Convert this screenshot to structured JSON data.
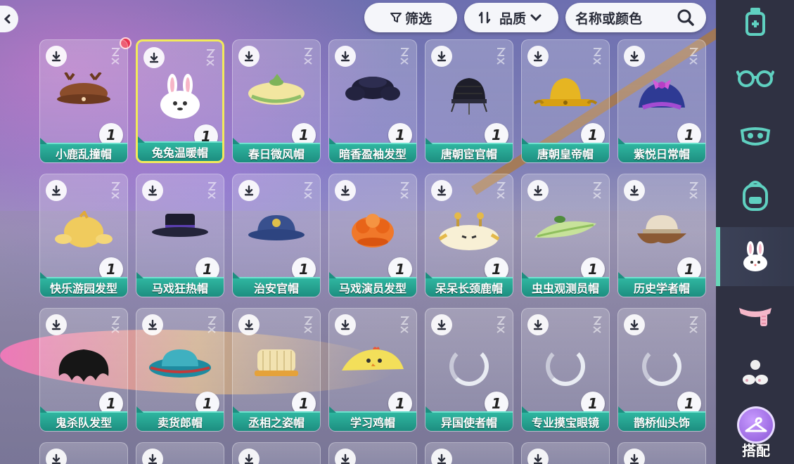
{
  "toolbar": {
    "filter_label": "筛选",
    "sort_label": "品质",
    "search_placeholder": "名称或颜色"
  },
  "sidebar": {
    "categories": [
      {
        "icon": "potion-bottle-icon"
      },
      {
        "icon": "glasses-icon"
      },
      {
        "icon": "face-mask-icon"
      },
      {
        "icon": "backpack-icon"
      },
      {
        "icon": "bunny-hat-icon",
        "active": true
      },
      {
        "icon": "scarf-icon"
      },
      {
        "icon": "shoes-icon"
      }
    ],
    "dress_up_label": "搭配"
  },
  "items": [
    {
      "name": "小鹿乱撞帽",
      "qty": "1"
    },
    {
      "name": "兔兔温暖帽",
      "qty": "1",
      "selected": true
    },
    {
      "name": "春日微风帽",
      "qty": "1"
    },
    {
      "name": "暗香盈袖发型",
      "qty": "1"
    },
    {
      "name": "唐朝宦官帽",
      "qty": "1"
    },
    {
      "name": "唐朝皇帝帽",
      "qty": "1"
    },
    {
      "name": "紫悦日常帽",
      "qty": "1"
    },
    {
      "name": "快乐游园发型",
      "qty": "1"
    },
    {
      "name": "马戏狂热帽",
      "qty": "1"
    },
    {
      "name": "治安官帽",
      "qty": "1"
    },
    {
      "name": "马戏演员发型",
      "qty": "1"
    },
    {
      "name": "呆呆长颈鹿帽",
      "qty": "1"
    },
    {
      "name": "虫虫观测员帽",
      "qty": "1"
    },
    {
      "name": "历史学者帽",
      "qty": "1"
    },
    {
      "name": "鬼杀队发型",
      "qty": "1"
    },
    {
      "name": "卖货郎帽",
      "qty": "1"
    },
    {
      "name": "丞相之姿帽",
      "qty": "1"
    },
    {
      "name": "学习鸡帽",
      "qty": "1"
    },
    {
      "name": "异国使者帽",
      "qty": "1",
      "loading": true
    },
    {
      "name": "专业摸宝眼镜",
      "qty": "1",
      "loading": true
    },
    {
      "name": "鹊桥仙头饰",
      "qty": "1",
      "loading": true
    }
  ],
  "colors": {
    "label_teal": "#1d8e80",
    "selected_border": "#f2ea5a",
    "sidebar_bg": "#2f3142",
    "active_accent": "#68d6b8"
  }
}
